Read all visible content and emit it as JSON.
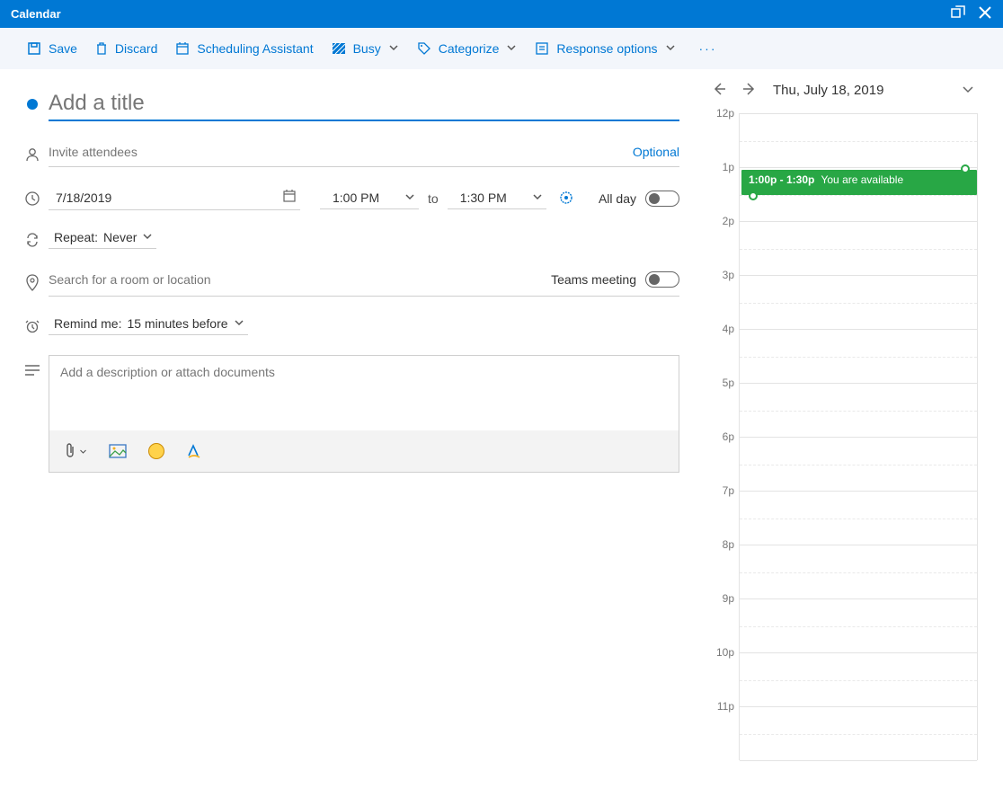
{
  "titlebar": {
    "title": "Calendar"
  },
  "cmd": {
    "save": "Save",
    "discard": "Discard",
    "scheduling": "Scheduling Assistant",
    "busy": "Busy",
    "categorize": "Categorize",
    "response": "Response options"
  },
  "form": {
    "title_placeholder": "Add a title",
    "attendees_placeholder": "Invite attendees",
    "optional": "Optional",
    "date": "7/18/2019",
    "start_time": "1:00 PM",
    "to": "to",
    "end_time": "1:30 PM",
    "allday": "All day",
    "repeat_label": "Repeat:",
    "repeat_value": "Never",
    "location_placeholder": "Search for a room or location",
    "teams": "Teams meeting",
    "remind_label": "Remind me:",
    "remind_value": "15 minutes before",
    "desc_placeholder": "Add a description or attach documents"
  },
  "preview": {
    "date": "Thu, July 18, 2019",
    "hours": [
      "12p",
      "1p",
      "2p",
      "3p",
      "4p",
      "5p",
      "6p",
      "7p",
      "8p",
      "9p",
      "10p",
      "11p"
    ],
    "event_time": "1:00p - 1:30p",
    "event_status": "You are available"
  }
}
